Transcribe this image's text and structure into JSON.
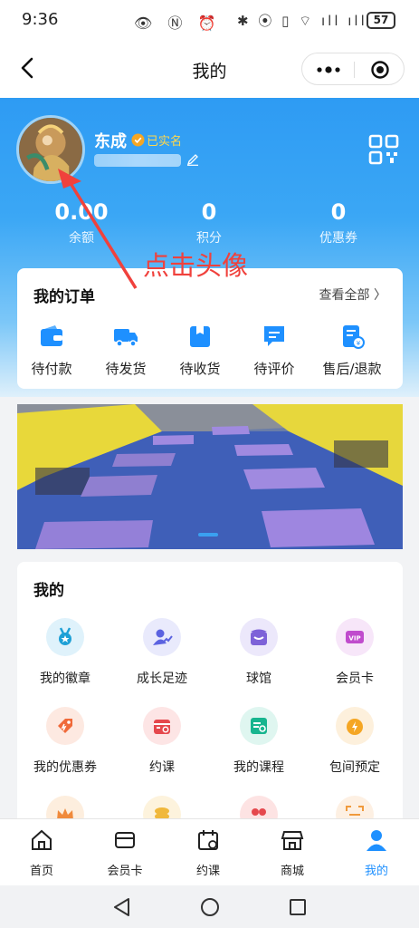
{
  "status_bar": {
    "time": "9:36",
    "left_icons": "👁 Ⓝ ⏰",
    "right_icons": "✱ ⦿ ▯ ⌔ ıll ıll",
    "battery": "57"
  },
  "title_bar": {
    "title": "我的"
  },
  "profile": {
    "name": "东成",
    "verified_label": "已实名",
    "stats": [
      {
        "value": "0.00",
        "label": "余额"
      },
      {
        "value": "0",
        "label": "积分"
      },
      {
        "value": "0",
        "label": "优惠券"
      }
    ]
  },
  "annotation": {
    "text": "点击头像",
    "color": "#f0413c"
  },
  "orders": {
    "title": "我的订单",
    "view_all": "查看全部 〉",
    "items": [
      {
        "label": "待付款",
        "icon": "wallet-icon"
      },
      {
        "label": "待发货",
        "icon": "truck-icon"
      },
      {
        "label": "待收货",
        "icon": "package-icon"
      },
      {
        "label": "待评价",
        "icon": "comment-icon"
      },
      {
        "label": "售后/退款",
        "icon": "refund-icon"
      }
    ]
  },
  "my_section": {
    "title": "我的",
    "items": [
      {
        "label": "我的徽章",
        "icon": "medal-icon",
        "bg": "#dff2fb",
        "color": "#1ea0d6"
      },
      {
        "label": "成长足迹",
        "icon": "growth-icon",
        "bg": "#e9eafc",
        "color": "#5b62e0"
      },
      {
        "label": "球馆",
        "icon": "venue-icon",
        "bg": "#ece8fb",
        "color": "#7d62d8"
      },
      {
        "label": "会员卡",
        "icon": "vip-card-icon",
        "bg": "#f7e6f9",
        "color": "#c04ccd"
      },
      {
        "label": "我的优惠券",
        "icon": "coupon-icon",
        "bg": "#fde9e1",
        "color": "#f06a3a"
      },
      {
        "label": "约课",
        "icon": "calendar-icon",
        "bg": "#fde5e5",
        "color": "#e5484d"
      },
      {
        "label": "我的课程",
        "icon": "course-icon",
        "bg": "#dff6f0",
        "color": "#17b58f"
      },
      {
        "label": "包间预定",
        "icon": "clock-icon",
        "bg": "#fdf0dc",
        "color": "#f5a623"
      },
      {
        "label": "",
        "icon": "crown-icon",
        "bg": "#fdeede",
        "color": "#f08a3c"
      },
      {
        "label": "",
        "icon": "coins-icon",
        "bg": "#fdf3dd",
        "color": "#f0b83c"
      },
      {
        "label": "",
        "icon": "group-icon",
        "bg": "#fde3e3",
        "color": "#e5484d"
      },
      {
        "label": "",
        "icon": "scan-icon",
        "bg": "#fdf0e3",
        "color": "#f09a3c"
      }
    ]
  },
  "tabs": [
    {
      "label": "首页",
      "icon": "home-icon"
    },
    {
      "label": "会员卡",
      "icon": "card-icon"
    },
    {
      "label": "约课",
      "icon": "calendar-icon"
    },
    {
      "label": "商城",
      "icon": "shop-icon"
    },
    {
      "label": "我的",
      "icon": "user-icon",
      "active": true
    }
  ],
  "colors": {
    "accent": "#1e90ff",
    "header_top": "#2e9bf3",
    "annotation": "#f0413c"
  }
}
